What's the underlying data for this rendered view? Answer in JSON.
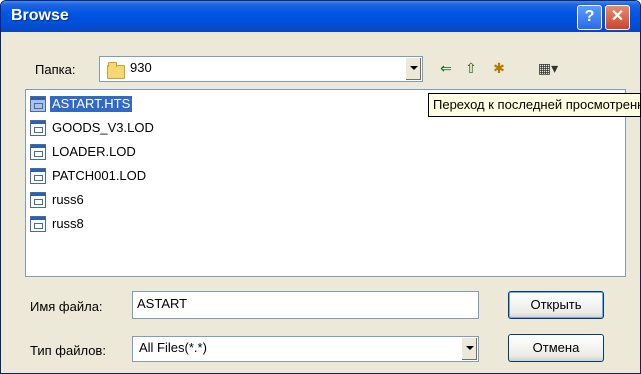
{
  "titlebar": {
    "title": "Browse",
    "help_glyph": "?",
    "close_glyph": "✕"
  },
  "lookin": {
    "label": "Папка:",
    "value": "930"
  },
  "toolbar": {
    "back_glyph": "⇐",
    "up_glyph": "⇧",
    "newfolder_glyph": "✱",
    "views_glyph": "▦▾"
  },
  "files": [
    {
      "name": "ASTART.HTS",
      "selected": true
    },
    {
      "name": "GOODS_V3.LOD"
    },
    {
      "name": "LOADER.LOD"
    },
    {
      "name": "PATCH001.LOD"
    },
    {
      "name": "russ6"
    },
    {
      "name": "russ8"
    }
  ],
  "tooltip": "Переход к последней просмотренной папке",
  "filename": {
    "label": "Имя файла:",
    "value": "ASTART"
  },
  "filetype": {
    "label": "Тип файлов:",
    "value": "All Files(*.*)"
  },
  "buttons": {
    "open": "Открыть",
    "cancel": "Отмена"
  },
  "colors": {
    "title_blue": "#0055e3",
    "selection": "#316ac5",
    "dialog_bg": "#ece9d8"
  }
}
